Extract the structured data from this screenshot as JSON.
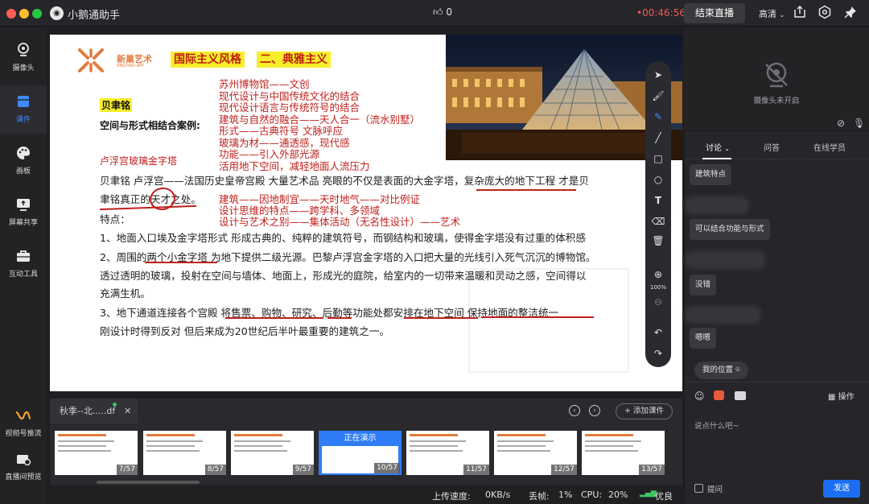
{
  "colors": {
    "accent": "#3d8bff",
    "timer": "#f05a5a",
    "send": "#1b6ef2",
    "slide_red": "#c0201c",
    "highlight": "#f8ee2a"
  },
  "titlebar": {
    "app_title": "小鹅通助手",
    "likes": "0",
    "timer": "00:46:56",
    "end_live": "结束直播",
    "quality": "高清",
    "icons": [
      "share-icon",
      "settings-icon",
      "pin-icon"
    ]
  },
  "sidebar": {
    "items": [
      {
        "label": "摄像头",
        "icon": "camera-icon"
      },
      {
        "label": "课件",
        "icon": "courseware-icon"
      },
      {
        "label": "画板",
        "icon": "palette-icon"
      },
      {
        "label": "屏幕共享",
        "icon": "screen-share-icon"
      },
      {
        "label": "互动工具",
        "icon": "toolbox-icon"
      },
      {
        "label": "视频号推流",
        "icon": "video-stream-icon"
      },
      {
        "label": "直播间预览",
        "icon": "preview-icon"
      }
    ]
  },
  "slide": {
    "logo_text": "新巢艺术",
    "tag1": "国际主义风格",
    "tag2": "二、典雅主义",
    "name": "贝聿铭",
    "case_title": "空间与形式相结合案例:",
    "pyramid_label": "卢浮宫玻璃金字塔",
    "notes": [
      "苏州博物馆——文创",
      "现代设计与中国传统文化的结合",
      "现代设计语言与传统符号的结合",
      "建筑与自然的融合——天人合一（流水别墅）",
      "形式——古典符号 文脉呼应",
      "玻璃为材——通透感，现代感",
      "功能——引入外部光源",
      "活用地下空间，减轻地面人流压力"
    ],
    "intro1": "贝聿铭 卢浮宫——法国历史皇帝宫殿 大量艺术品 亮眼的不仅是表面的大金字塔，复杂庞大的地下工程 才是贝",
    "intro2": "聿铭真正的天才之处。",
    "notes2": [
      "建筑——因地制宜——天时地气——对比例证",
      "设计思维的特点——跨学科、多领域",
      "设计与艺术之别——集体活动（无名性设计）——艺术"
    ],
    "feature_title": "特点：",
    "features": [
      "1、地面入口埃及金字塔形式 形成古典的、纯粹的建筑符号，而钢结构和玻璃，使得金字塔没有过重的体积感",
      "2、周围的两个小金字塔 为地下提供二级光源。巴黎卢浮宫金字塔的入口把大量的光线引入死气沉沉的博物馆。",
      "透过透明的玻璃，投射在空间与墙体、地面上，形成光的庭院，给室内的一切带来温暖和灵动之感，空间得以",
      "充满生机。",
      "3、地下通道连接各个宫殿 将售票、购物、研究、后勤等功能处都安排在地下空间 保持地面的整洁统一",
      "刚设计时得到反对 但后来成为20世纪后半叶最重要的建筑之一。"
    ]
  },
  "drawtools": {
    "tools": [
      "pointer-icon",
      "brush-icon",
      "pen-icon",
      "line-icon",
      "rect-icon",
      "circle-icon",
      "text-icon",
      "eraser-icon",
      "trash-icon",
      "zoom-in-icon"
    ],
    "zoom": "100%",
    "after": [
      "zoom-out-icon",
      "undo-icon",
      "redo-icon"
    ]
  },
  "camera_panel": {
    "status": "摄像头未开启"
  },
  "chat": {
    "tabs": [
      "讨论",
      "问答",
      "在线学员"
    ],
    "messages": [
      "建筑特点",
      "可以结合功能与形式",
      "没错",
      "嗯嗯"
    ],
    "my_position": "我的位置",
    "actions_label": "操作",
    "placeholder": "说点什么吧~",
    "ask_label": "提问",
    "send_label": "发送"
  },
  "courseware": {
    "file_name": "秋季--北.....df",
    "add_label": "+ 添加课件",
    "current_label": "正在演示",
    "pages": [
      "7/57",
      "8/57",
      "9/57",
      "10/57",
      "11/57",
      "12/57",
      "13/57"
    ]
  },
  "status": {
    "upload_label": "上传速度:",
    "upload_value": "0KB/s",
    "drop_label": "丢帧:",
    "drop_value": "1%",
    "cpu_label": "CPU:",
    "cpu_value": "20%",
    "quality_label": "优良"
  }
}
